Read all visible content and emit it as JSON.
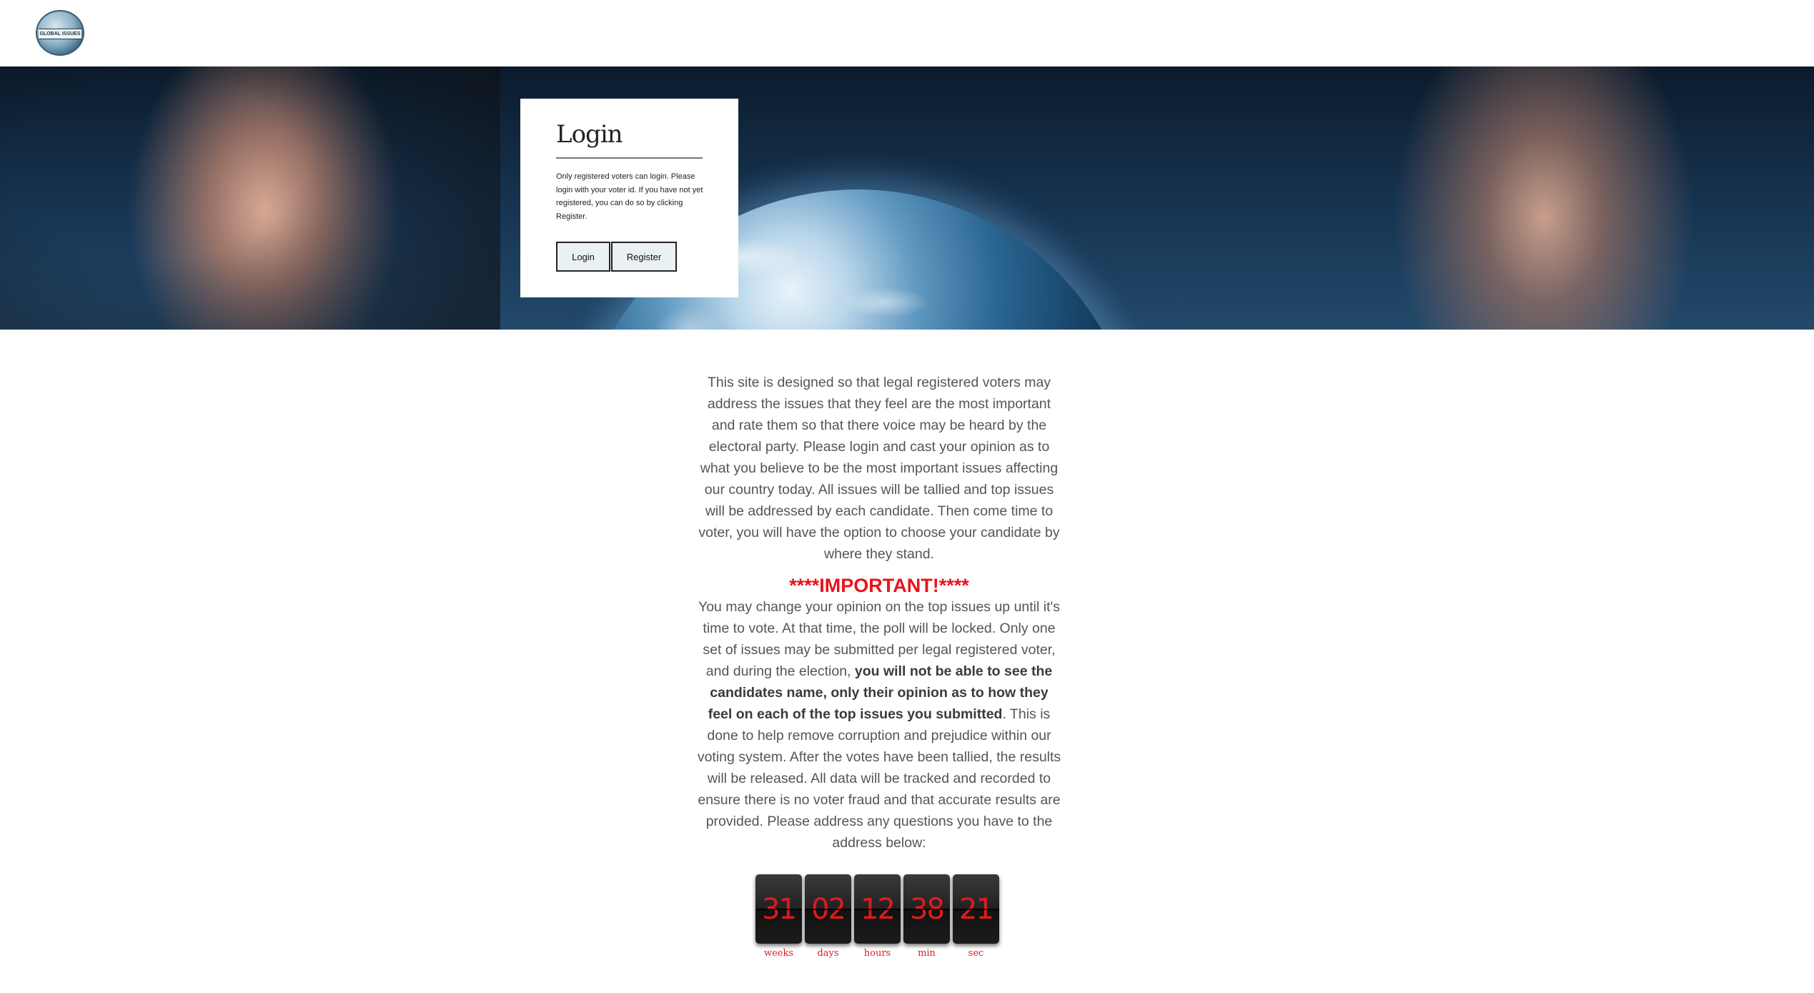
{
  "header": {
    "logo_text": "GLOBAL ISSUES"
  },
  "login": {
    "title": "Login",
    "description": "Only registered voters can login. Please login with your voter id. If you have not yet registered, you can do so by clicking Register.",
    "login_label": "Login",
    "register_label": "Register"
  },
  "main": {
    "intro": "This site is designed so that legal registered voters may address the issues that they feel are the most important and rate them so that there voice may be heard by the electoral party. Please login and cast your opinion as to what you believe to be the most important issues affecting our country today. All issues will be tallied and top issues will be addressed by each candidate. Then come time to voter, you will have the option to choose your candidate by where they stand.",
    "important_heading": "****IMPORTANT!****",
    "important_part1": "You may change your opinion on the top issues up until it's time to vote. At that time, the poll will be locked. Only one set of issues may be submitted per legal registered voter, and during the election, ",
    "important_bold": "you will not be able to see the candidates name, only their opinion as to how they feel on each of the top issues you submitted",
    "important_part2": ". This is done to help remove corruption and prejudice within our voting system. After the votes have been tallied, the results will be released. All data will be tracked and recorded to ensure there is no voter fraud and that accurate results are provided. Please address any questions you have to the address below:"
  },
  "countdown": {
    "units": [
      {
        "value": "31",
        "label": "weeks"
      },
      {
        "value": "02",
        "label": "days"
      },
      {
        "value": "12",
        "label": "hours"
      },
      {
        "value": "38",
        "label": "min"
      },
      {
        "value": "21",
        "label": "sec"
      }
    ],
    "digit_color": "#e11a1e"
  },
  "colors": {
    "accent_red": "#e8141a",
    "body_text": "#555555"
  }
}
